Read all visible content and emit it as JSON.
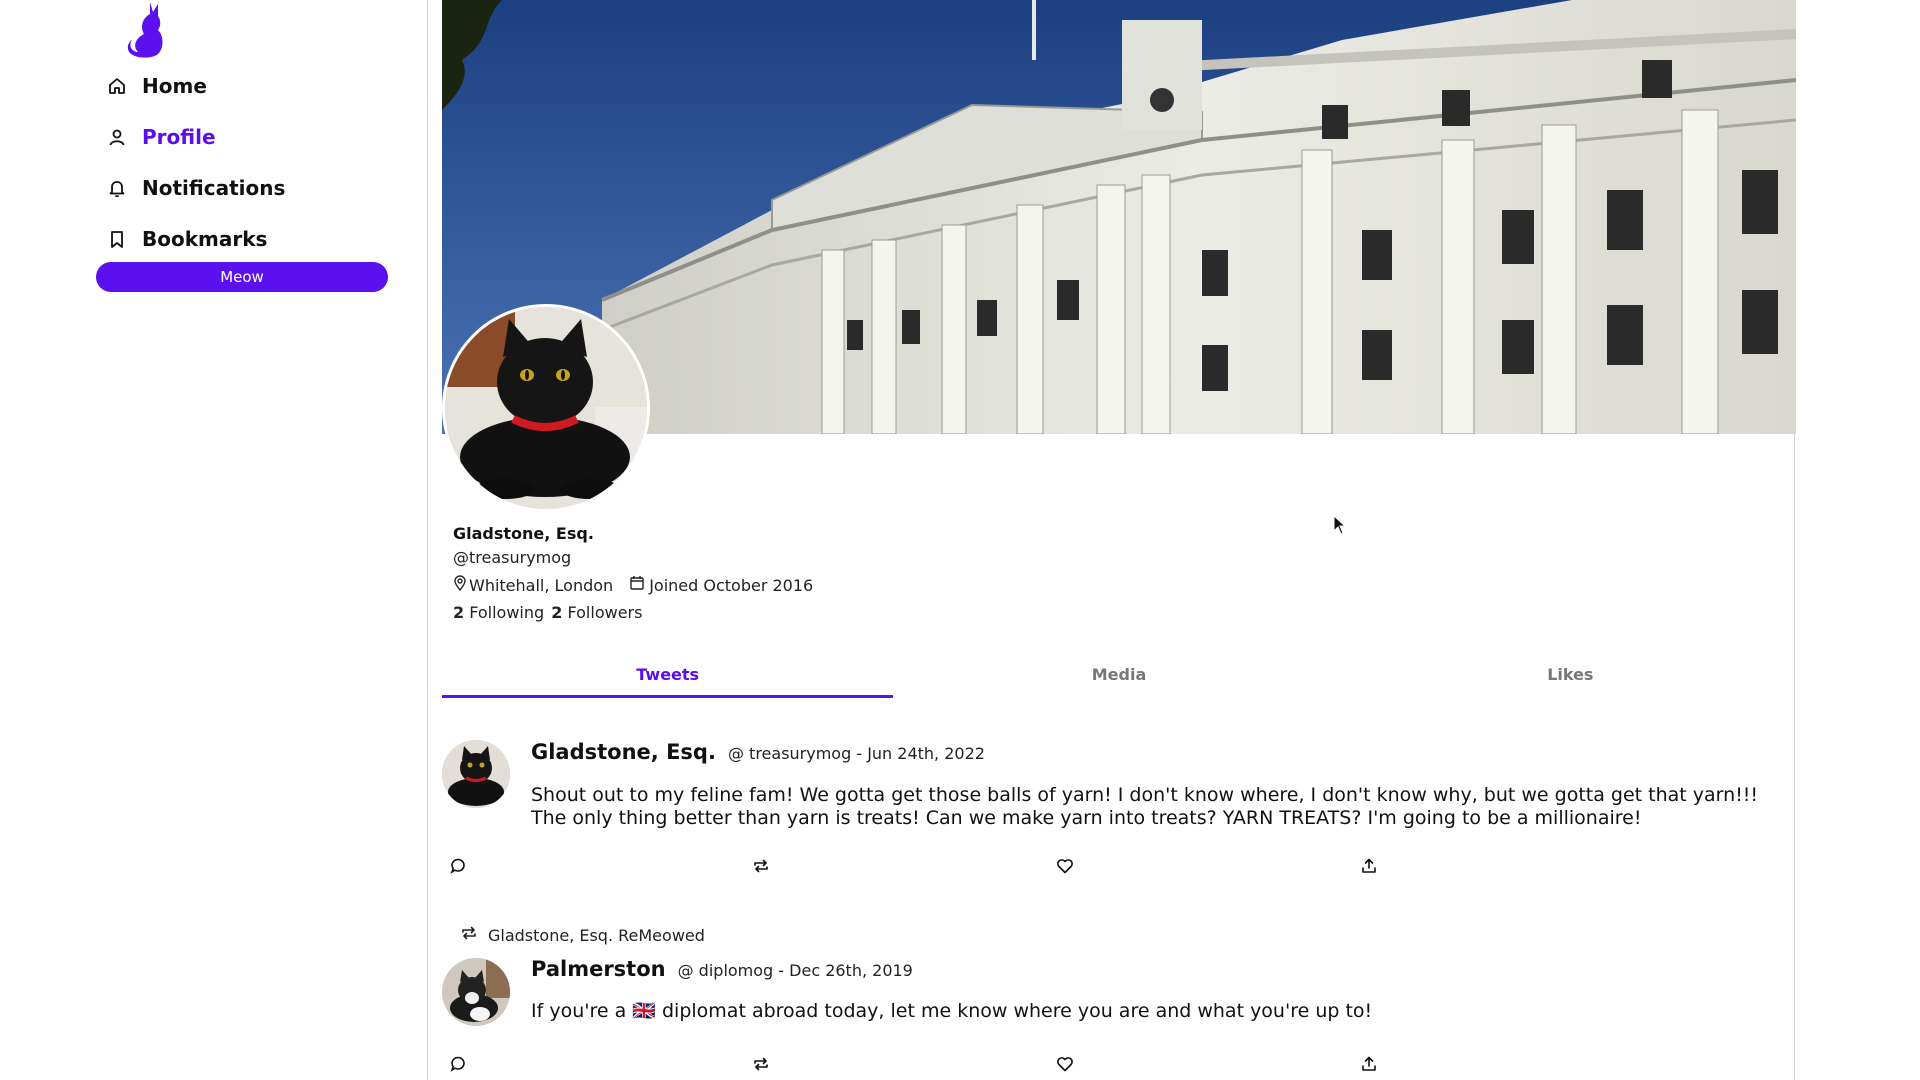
{
  "sidebar": {
    "logo": "cat-logo-icon",
    "items": [
      {
        "label": "Home",
        "icon": "home-icon"
      },
      {
        "label": "Profile",
        "icon": "user-icon",
        "active": true
      },
      {
        "label": "Notifications",
        "icon": "bell-icon"
      },
      {
        "label": "Bookmarks",
        "icon": "bookmark-icon"
      }
    ],
    "meow_button": "Meow"
  },
  "colors": {
    "accent": "#5b10f0",
    "text": "#111111",
    "muted": "#777777",
    "border": "#d0d0d0"
  },
  "profile": {
    "display_name": "Gladstone, Esq.",
    "handle": "@treasurymog",
    "location": "Whitehall, London",
    "joined": "Joined October 2016",
    "following_count": "2",
    "following_label": "Following",
    "followers_count": "2",
    "followers_label": "Followers"
  },
  "tabs": [
    {
      "label": "Tweets",
      "active": true
    },
    {
      "label": "Media"
    },
    {
      "label": "Likes"
    }
  ],
  "tweets": [
    {
      "name": "Gladstone, Esq.",
      "sub": "@ treasurymog - Jun 24th, 2022",
      "body": "Shout out to my feline fam! We gotta get those balls of yarn! I don't know where, I don't know why, but we gotta get that yarn!!! The only thing better than yarn is treats! Can we make yarn into treats? YARN TREATS? I'm going to be a millionaire!"
    },
    {
      "remeow_by": "Gladstone, Esq. ReMeowed",
      "name": "Palmerston",
      "sub": "@ diplomog - Dec 26th, 2019",
      "body_before": "If you're a",
      "flag": "🇬🇧",
      "body_after": "diplomat abroad today, let me know where you are and what you're up to!"
    }
  ],
  "actions": [
    "reply-icon",
    "remeow-icon",
    "like-icon",
    "share-icon"
  ]
}
